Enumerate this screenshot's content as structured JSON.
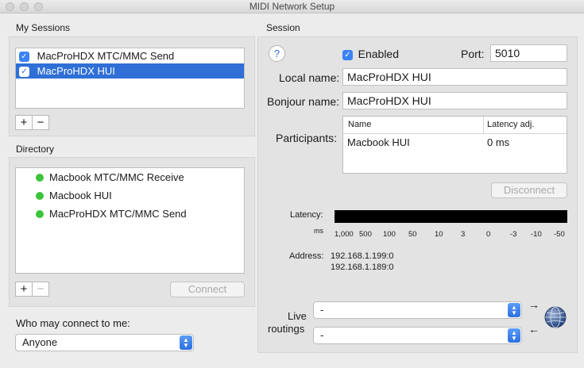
{
  "window": {
    "title": "MIDI Network Setup"
  },
  "my_sessions": {
    "label": "My Sessions",
    "items": [
      {
        "label": "MacProHDX MTC/MMC Send",
        "checked": true,
        "selected": false
      },
      {
        "label": "MacProHDX HUI",
        "checked": true,
        "selected": true
      }
    ],
    "add_label": "+",
    "remove_label": "−"
  },
  "directory": {
    "label": "Directory",
    "items": [
      {
        "label": "Macbook MTC/MMC Receive",
        "status": "online"
      },
      {
        "label": "Macbook HUI",
        "status": "online"
      },
      {
        "label": "MacProHDX MTC/MMC Send",
        "status": "online"
      }
    ],
    "add_label": "+",
    "remove_label": "−",
    "connect_label": "Connect"
  },
  "who_may_connect": {
    "label": "Who may connect to me:",
    "value": "Anyone"
  },
  "session": {
    "label": "Session",
    "help_label": "?",
    "enabled_label": "Enabled",
    "enabled": true,
    "port_label": "Port:",
    "port_value": "5010",
    "local_name_label": "Local name:",
    "local_name_value": "MacProHDX HUI",
    "bonjour_name_label": "Bonjour name:",
    "bonjour_name_value": "MacProHDX HUI",
    "participants_label": "Participants:",
    "participants_columns": [
      "Name",
      "Latency adj."
    ],
    "participants": [
      {
        "name": "Macbook HUI",
        "latency": "0 ms"
      }
    ],
    "disconnect_label": "Disconnect",
    "latency_label": "Latency:",
    "latency_unit": "ms",
    "latency_ticks": [
      "1,000",
      "500",
      "100",
      "50",
      "10",
      "3",
      "0",
      "-3",
      "-10",
      "-50"
    ],
    "address_label": "Address:",
    "addresses": [
      "192.168.1.199:0",
      "192.168.1.189:0"
    ],
    "live_routings_label_1": "Live",
    "live_routings_label_2": "routings",
    "routing_in_value": "-",
    "routing_out_value": "-"
  },
  "colors": {
    "accent": "#2f6fd6",
    "online": "#3cc33c",
    "meter": "#000000"
  }
}
